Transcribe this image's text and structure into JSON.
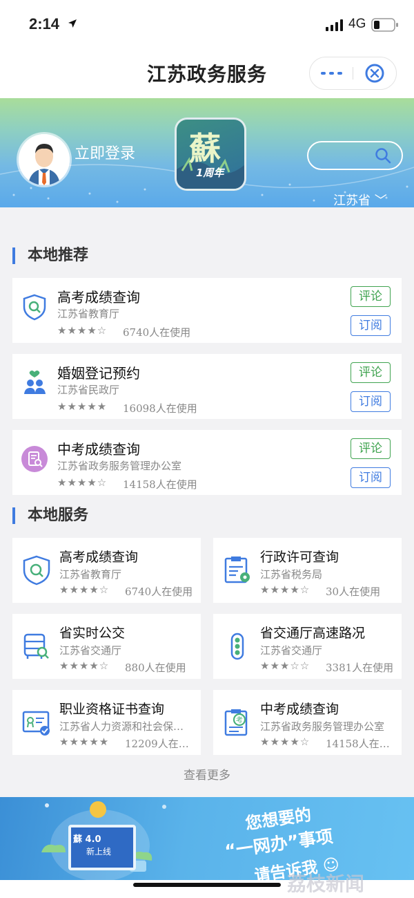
{
  "status_bar": {
    "time": "2:14",
    "network": "4G"
  },
  "nav": {
    "title": "江苏政务服务"
  },
  "banner": {
    "login_label": "立即登录",
    "region": "江苏省 ﹀",
    "app_icon_text": "蘇",
    "app_icon_badge": "1周年"
  },
  "sections": {
    "recommend_title": "本地推荐",
    "service_title": "本地服务"
  },
  "actions": {
    "comment": "评论",
    "subscribe": "订阅"
  },
  "recommend": [
    {
      "name": "高考成绩查询",
      "org": "江苏省教育厅",
      "stars": "★★★★☆",
      "users": "6740人在使用",
      "icon": "shield-search-icon"
    },
    {
      "name": "婚姻登记预约",
      "org": "江苏省民政厅",
      "stars": "★★★★★",
      "users": "16098人在使用",
      "icon": "couple-heart-icon"
    },
    {
      "name": "中考成绩查询",
      "org": "江苏省政务服务管理办公室",
      "stars": "★★★★☆",
      "users": "14158人在使用",
      "icon": "document-search-icon"
    }
  ],
  "services": [
    {
      "name": "高考成绩查询",
      "org": "江苏省教育厅",
      "stars": "★★★★☆",
      "users": "6740人在使用",
      "icon": "shield-search-icon"
    },
    {
      "name": "行政许可查询",
      "org": "江苏省税务局",
      "stars": "★★★★☆",
      "users": "30人在使用",
      "icon": "license-gear-icon"
    },
    {
      "name": "省实时公交",
      "org": "江苏省交通厅",
      "stars": "★★★★☆",
      "users": "880人在使用",
      "icon": "bus-search-icon"
    },
    {
      "name": "省交通厅高速路况",
      "org": "江苏省交通厅",
      "stars": "★★★☆☆",
      "users": "3381人在使用",
      "icon": "traffic-light-icon"
    },
    {
      "name": "职业资格证书查询",
      "org": "江苏省人力资源和社会保…",
      "stars": "★★★★★",
      "users": "12209人在…",
      "icon": "certificate-icon"
    },
    {
      "name": "中考成绩查询",
      "org": "江苏省政务服务管理办公室",
      "stars": "★★★★☆",
      "users": "14158人在…",
      "icon": "exam-document-icon"
    }
  ],
  "more_label": "查看更多",
  "ad": {
    "line1": "您想要的",
    "line2": "“一网办”事项",
    "line3": "请告诉我 ☺",
    "badge_line1": "蘇 4.0",
    "badge_line2": "新上线"
  },
  "watermark": "荔枝新闻"
}
